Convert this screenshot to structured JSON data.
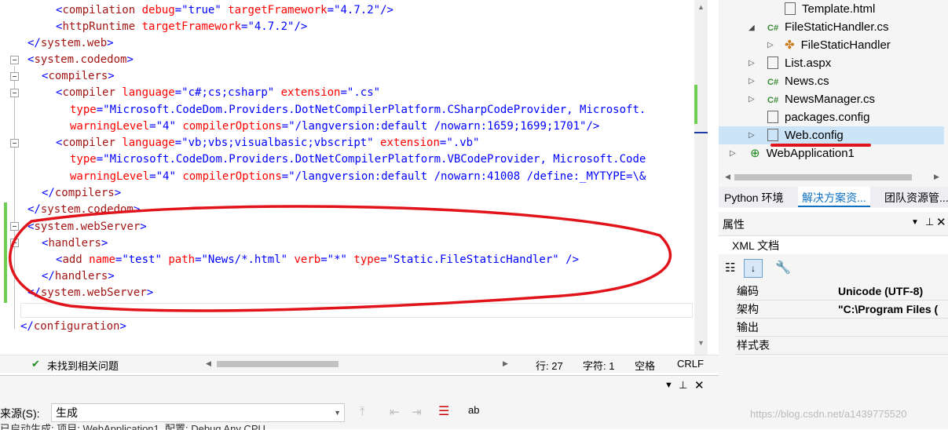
{
  "editor": {
    "lines": [
      {
        "tokens": [
          {
            "t": "<",
            "c": "pun"
          },
          {
            "t": "compilation",
            "c": "tag"
          },
          {
            "t": " debug",
            "c": "attr"
          },
          {
            "t": "=",
            "c": "pun"
          },
          {
            "t": "\"true\"",
            "c": "val"
          },
          {
            "t": " targetFramework",
            "c": "attr"
          },
          {
            "t": "=",
            "c": "pun"
          },
          {
            "t": "\"4.7.2\"",
            "c": "val"
          },
          {
            "t": "/>",
            "c": "pun"
          }
        ],
        "indent": "  "
      },
      {
        "tokens": [
          {
            "t": "<",
            "c": "pun"
          },
          {
            "t": "httpRuntime",
            "c": "tag"
          },
          {
            "t": " targetFramework",
            "c": "attr"
          },
          {
            "t": "=",
            "c": "pun"
          },
          {
            "t": "\"4.7.2\"",
            "c": "val"
          },
          {
            "t": "/>",
            "c": "pun"
          }
        ],
        "indent": "  "
      },
      {
        "tokens": [
          {
            "t": "</",
            "c": "pun"
          },
          {
            "t": "system.web",
            "c": "tag"
          },
          {
            "t": ">",
            "c": "pun"
          }
        ],
        "indent": " "
      },
      {
        "tokens": [
          {
            "t": "<",
            "c": "pun"
          },
          {
            "t": "system.codedom",
            "c": "tag"
          },
          {
            "t": ">",
            "c": "pun"
          }
        ],
        "indent": " "
      },
      {
        "tokens": [
          {
            "t": "<",
            "c": "pun"
          },
          {
            "t": "compilers",
            "c": "tag"
          },
          {
            "t": ">",
            "c": "pun"
          }
        ],
        "indent": "  "
      },
      {
        "tokens": [
          {
            "t": "<",
            "c": "pun"
          },
          {
            "t": "compiler",
            "c": "tag"
          },
          {
            "t": " language",
            "c": "attr"
          },
          {
            "t": "=",
            "c": "pun"
          },
          {
            "t": "\"c#;cs;csharp\"",
            "c": "val"
          },
          {
            "t": " extension",
            "c": "attr"
          },
          {
            "t": "=",
            "c": "pun"
          },
          {
            "t": "\".cs\"",
            "c": "val"
          }
        ],
        "indent": "    "
      },
      {
        "tokens": [
          {
            "t": "type",
            "c": "attr"
          },
          {
            "t": "=",
            "c": "pun"
          },
          {
            "t": "\"Microsoft.CodeDom.Providers.DotNetCompilerPlatform.CSharpCodeProvider, Microsoft.",
            "c": "val"
          }
        ],
        "indent": "      "
      },
      {
        "tokens": [
          {
            "t": "warningLevel",
            "c": "attr"
          },
          {
            "t": "=",
            "c": "pun"
          },
          {
            "t": "\"4\"",
            "c": "val"
          },
          {
            "t": " compilerOptions",
            "c": "attr"
          },
          {
            "t": "=",
            "c": "pun"
          },
          {
            "t": "\"/langversion:default /nowarn:1659;1699;1701\"",
            "c": "val"
          },
          {
            "t": "/>",
            "c": "pun"
          }
        ],
        "indent": "      "
      },
      {
        "tokens": [
          {
            "t": "<",
            "c": "pun"
          },
          {
            "t": "compiler",
            "c": "tag"
          },
          {
            "t": " language",
            "c": "attr"
          },
          {
            "t": "=",
            "c": "pun"
          },
          {
            "t": "\"vb;vbs;visualbasic;vbscript\"",
            "c": "val"
          },
          {
            "t": " extension",
            "c": "attr"
          },
          {
            "t": "=",
            "c": "pun"
          },
          {
            "t": "\".vb\"",
            "c": "val"
          }
        ],
        "indent": "    "
      },
      {
        "tokens": [
          {
            "t": "type",
            "c": "attr"
          },
          {
            "t": "=",
            "c": "pun"
          },
          {
            "t": "\"Microsoft.CodeDom.Providers.DotNetCompilerPlatform.VBCodeProvider, Microsoft.Code",
            "c": "val"
          }
        ],
        "indent": "      "
      },
      {
        "tokens": [
          {
            "t": "warningLevel",
            "c": "attr"
          },
          {
            "t": "=",
            "c": "pun"
          },
          {
            "t": "\"4\"",
            "c": "val"
          },
          {
            "t": " compilerOptions",
            "c": "attr"
          },
          {
            "t": "=",
            "c": "pun"
          },
          {
            "t": "\"/langversion:default /nowarn:41008 /define:_MYTYPE=\\&",
            "c": "val"
          }
        ],
        "indent": "      "
      },
      {
        "tokens": [
          {
            "t": "</",
            "c": "pun"
          },
          {
            "t": "compilers",
            "c": "tag"
          },
          {
            "t": ">",
            "c": "pun"
          }
        ],
        "indent": "  "
      },
      {
        "tokens": [
          {
            "t": "</",
            "c": "pun"
          },
          {
            "t": "system.codedom",
            "c": "tag"
          },
          {
            "t": ">",
            "c": "pun"
          }
        ],
        "indent": " "
      },
      {
        "tokens": [
          {
            "t": "<",
            "c": "pun"
          },
          {
            "t": "system.webServer",
            "c": "tag"
          },
          {
            "t": ">",
            "c": "pun"
          }
        ],
        "indent": " "
      },
      {
        "tokens": [
          {
            "t": "<",
            "c": "pun"
          },
          {
            "t": "handlers",
            "c": "tag"
          },
          {
            "t": ">",
            "c": "pun"
          }
        ],
        "indent": "  "
      },
      {
        "tokens": [
          {
            "t": "<",
            "c": "pun"
          },
          {
            "t": "add",
            "c": "tag"
          },
          {
            "t": " name",
            "c": "attr"
          },
          {
            "t": "=",
            "c": "pun"
          },
          {
            "t": "\"test\"",
            "c": "val"
          },
          {
            "t": " path",
            "c": "attr"
          },
          {
            "t": "=",
            "c": "pun"
          },
          {
            "t": "\"News/*.html\"",
            "c": "val"
          },
          {
            "t": " verb",
            "c": "attr"
          },
          {
            "t": "=",
            "c": "pun"
          },
          {
            "t": "\"*\"",
            "c": "val"
          },
          {
            "t": " type",
            "c": "attr"
          },
          {
            "t": "=",
            "c": "pun"
          },
          {
            "t": "\"Static.FileStaticHandler\"",
            "c": "val"
          },
          {
            "t": " />",
            "c": "pun"
          }
        ],
        "indent": "    "
      },
      {
        "tokens": [
          {
            "t": "</",
            "c": "pun"
          },
          {
            "t": "handlers",
            "c": "tag"
          },
          {
            "t": ">",
            "c": "pun"
          }
        ],
        "indent": "  "
      },
      {
        "tokens": [
          {
            "t": "</",
            "c": "pun"
          },
          {
            "t": "system.webServer",
            "c": "tag"
          },
          {
            "t": ">",
            "c": "pun"
          }
        ],
        "indent": " "
      },
      {
        "tokens": [],
        "indent": ""
      },
      {
        "tokens": [
          {
            "t": "</",
            "c": "pun"
          },
          {
            "t": "configuration",
            "c": "tag"
          },
          {
            "t": ">",
            "c": "pun"
          }
        ],
        "indent": ""
      }
    ]
  },
  "status": {
    "issues": "未找到相关问题",
    "row": "行: 27",
    "col": "字符: 1",
    "space": "空格",
    "eol": "CRLF"
  },
  "output": {
    "source_label": "来源(S):",
    "source_value": "生成",
    "partial": "已启动生成: 项目: WebApplication1, 配置: Debug Any CPU"
  },
  "solution": {
    "items": [
      "Template.html",
      "FileStaticHandler.cs",
      "FileStaticHandler",
      "List.aspx",
      "News.cs",
      "NewsManager.cs",
      "packages.config",
      "Web.config",
      "WebApplication1"
    ]
  },
  "tabs": [
    "Python 环境",
    "解决方案资...",
    "团队资源管..."
  ],
  "properties": {
    "title": "属性",
    "type": "XML 文档",
    "rows": [
      {
        "k": "编码",
        "v": "Unicode (UTF-8)"
      },
      {
        "k": "架构",
        "v": "\"C:\\Program Files ("
      },
      {
        "k": "输出",
        "v": ""
      },
      {
        "k": "样式表",
        "v": ""
      }
    ]
  },
  "watermark": "https://blog.csdn.net/a1439775520"
}
